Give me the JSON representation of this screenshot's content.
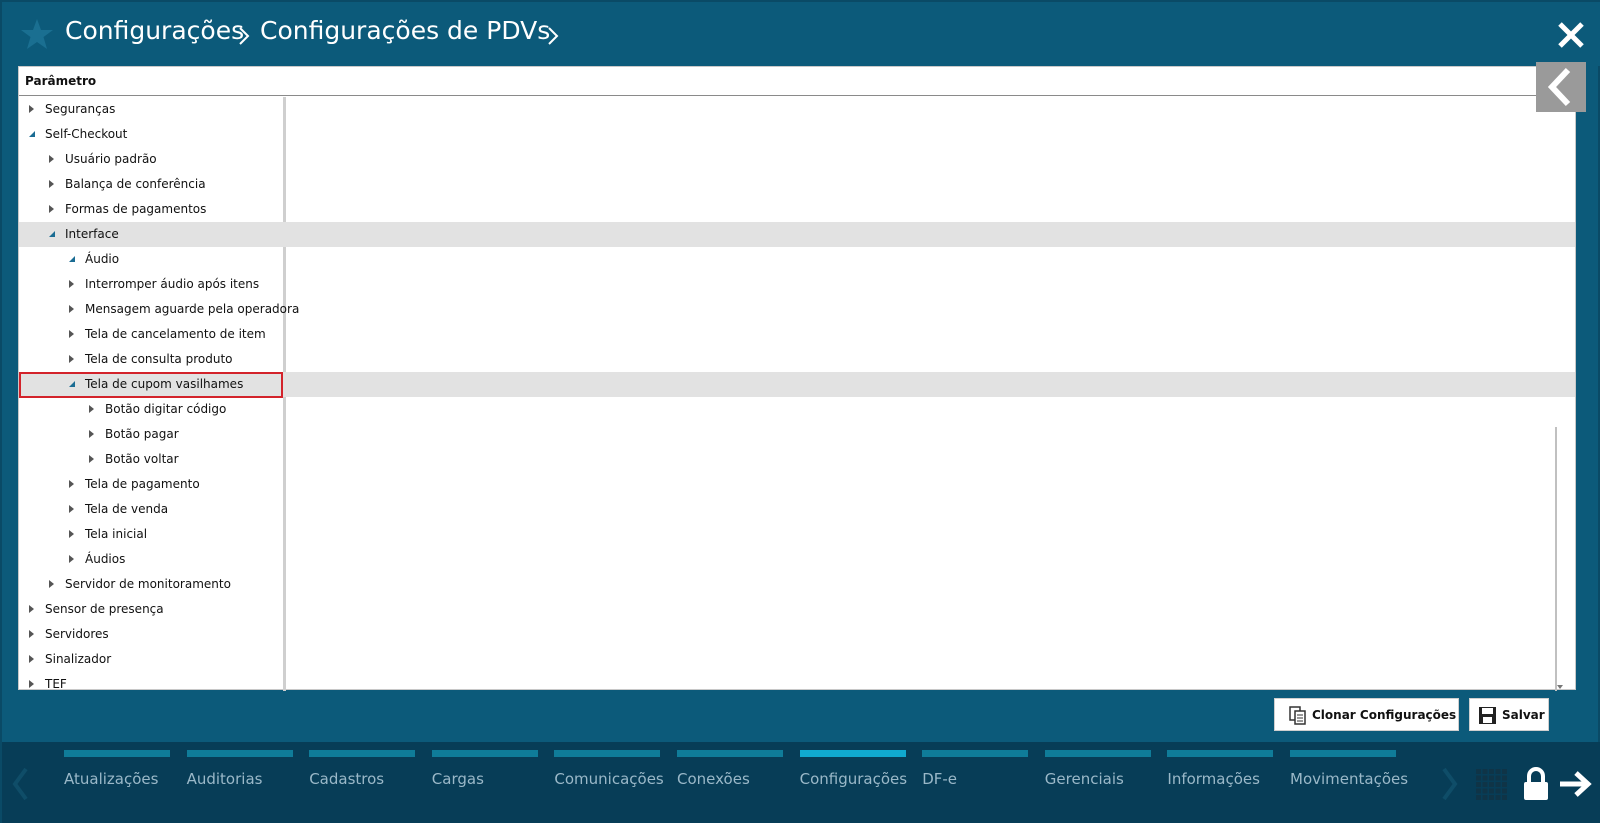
{
  "header": {
    "breadcrumb": [
      "Configurações",
      "Configurações de PDVs"
    ],
    "icons": [
      "star-icon",
      "close-icon"
    ]
  },
  "panel": {
    "column_header": "Parâmetro",
    "tree": [
      {
        "label": "Seguranças",
        "level": 0,
        "expanded": false
      },
      {
        "label": "Self-Checkout",
        "level": 0,
        "expanded": true
      },
      {
        "label": "Usuário padrão",
        "level": 1,
        "expanded": false
      },
      {
        "label": "Balança de conferência",
        "level": 1,
        "expanded": false
      },
      {
        "label": "Formas de pagamentos",
        "level": 1,
        "expanded": false
      },
      {
        "label": "Interface",
        "level": 1,
        "expanded": true,
        "selected": true
      },
      {
        "label": "Áudio",
        "level": 2,
        "expanded": true
      },
      {
        "label": "Interromper áudio após itens",
        "level": 2,
        "expanded": false
      },
      {
        "label": "Mensagem aguarde pela operadora",
        "level": 2,
        "expanded": false
      },
      {
        "label": "Tela de cancelamento de item",
        "level": 2,
        "expanded": false
      },
      {
        "label": "Tela de consulta produto",
        "level": 2,
        "expanded": false
      },
      {
        "label": "Tela de cupom vasilhames",
        "level": 2,
        "expanded": true,
        "selected": true,
        "highlighted": true
      },
      {
        "label": "Botão digitar código",
        "level": 3,
        "expanded": false
      },
      {
        "label": "Botão pagar",
        "level": 3,
        "expanded": false
      },
      {
        "label": "Botão voltar",
        "level": 3,
        "expanded": false
      },
      {
        "label": "Tela de pagamento",
        "level": 2,
        "expanded": false
      },
      {
        "label": "Tela de venda",
        "level": 2,
        "expanded": false
      },
      {
        "label": "Tela inicial",
        "level": 2,
        "expanded": false
      },
      {
        "label": "Áudios",
        "level": 2,
        "expanded": false
      },
      {
        "label": "Servidor de monitoramento",
        "level": 1,
        "expanded": false
      },
      {
        "label": "Sensor de presença",
        "level": 0,
        "expanded": false
      },
      {
        "label": "Servidores",
        "level": 0,
        "expanded": false
      },
      {
        "label": "Sinalizador",
        "level": 0,
        "expanded": false
      },
      {
        "label": "TEF",
        "level": 0,
        "expanded": false
      }
    ]
  },
  "actions": {
    "clone_label": "Clonar Configurações",
    "save_label": "Salvar"
  },
  "nav": {
    "tabs": [
      "Atualizações",
      "Auditorias",
      "Cadastros",
      "Cargas",
      "Comunicações",
      "Conexões",
      "Configurações",
      "DF-e",
      "Gerenciais",
      "Informações",
      "Movimentações"
    ],
    "active_tab": "Configurações"
  },
  "colors": {
    "header_bg": "#0c5a7a",
    "nav_bg": "#073d57",
    "tab_bar": "#0f7c99",
    "tab_bar_active": "#10a9cf",
    "selection": "#e2e2e2",
    "highlight_border": "#d3232b"
  }
}
